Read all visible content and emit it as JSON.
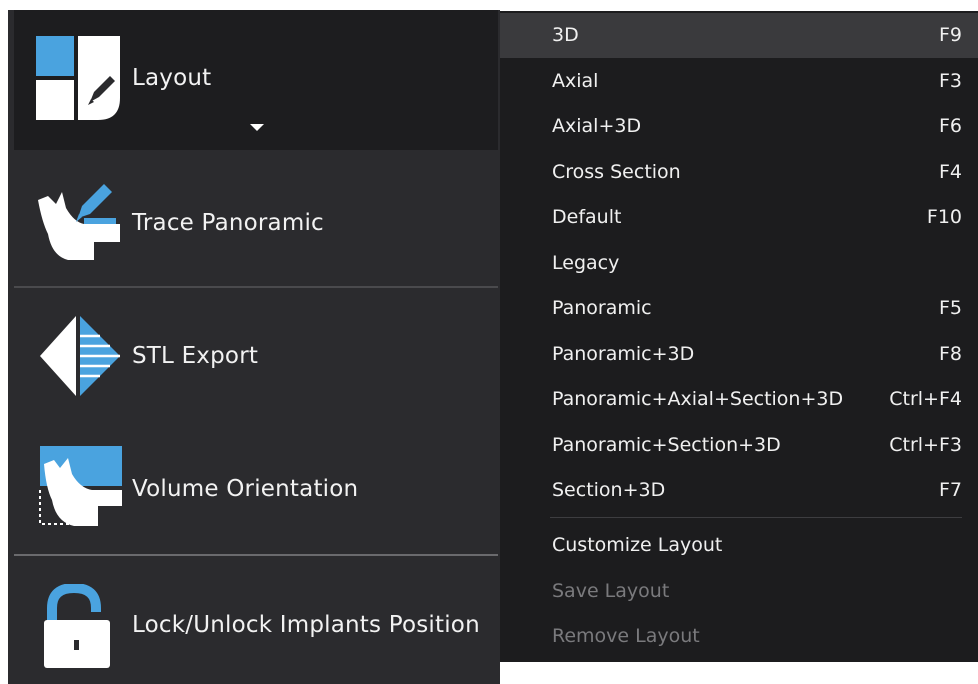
{
  "tools": {
    "layout": {
      "label": "Layout",
      "icon": "layout-edit-icon",
      "dropdown_icon": "caret-down-icon"
    },
    "trace_panoramic": {
      "label": "Trace Panoramic",
      "icon": "jaw-pen-icon"
    },
    "stl_export": {
      "label": "STL Export",
      "icon": "stl-prism-icon"
    },
    "volume_orientation": {
      "label": "Volume Orientation",
      "icon": "jaw-orientation-icon"
    },
    "lock_unlock": {
      "label": "Lock/Unlock Implants Position",
      "icon": "padlock-open-icon"
    }
  },
  "menu": {
    "items": [
      {
        "label": "3D",
        "shortcut": "F9",
        "highlighted": true
      },
      {
        "label": "Axial",
        "shortcut": "F3"
      },
      {
        "label": "Axial+3D",
        "shortcut": "F6"
      },
      {
        "label": "Cross Section",
        "shortcut": "F4"
      },
      {
        "label": "Default",
        "shortcut": "F10"
      },
      {
        "label": "Legacy",
        "shortcut": ""
      },
      {
        "label": "Panoramic",
        "shortcut": "F5"
      },
      {
        "label": "Panoramic+3D",
        "shortcut": "F8"
      },
      {
        "label": "Panoramic+Axial+Section+3D",
        "shortcut": "Ctrl+F4"
      },
      {
        "label": "Panoramic+Section+3D",
        "shortcut": "Ctrl+F3"
      },
      {
        "label": "Section+3D",
        "shortcut": "F7"
      }
    ],
    "actions": [
      {
        "label": "Customize Layout",
        "enabled": true
      },
      {
        "label": "Save Layout",
        "enabled": false
      },
      {
        "label": "Remove Layout",
        "enabled": false
      }
    ]
  },
  "colors": {
    "accent_blue": "#4aa3df",
    "panel_bg": "#2b2b2e",
    "menu_bg": "#1c1c1e",
    "highlight_bg": "#3a3a3d",
    "disabled_text": "#7a7a7d"
  }
}
